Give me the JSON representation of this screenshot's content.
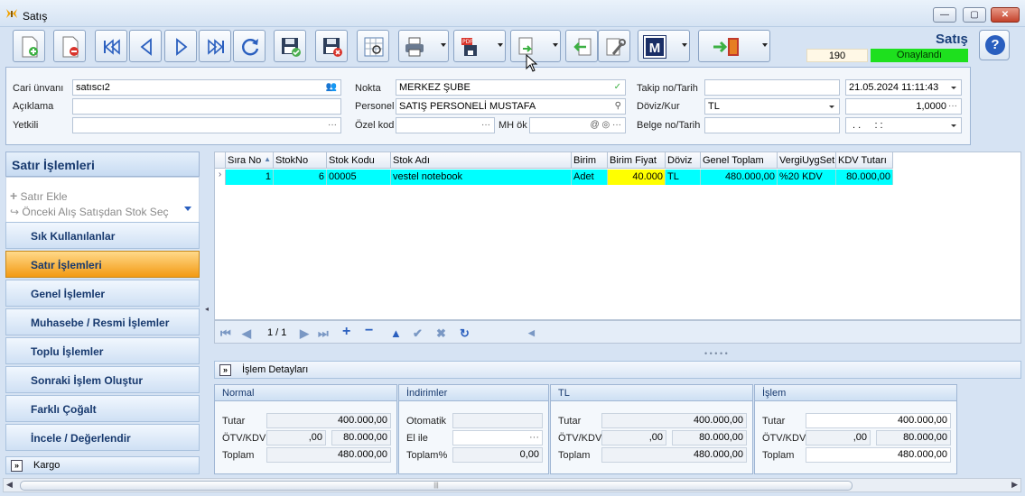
{
  "window": {
    "title": "Satış",
    "min": "—",
    "max": "▢",
    "close": "✕"
  },
  "toolbar": {
    "form_title": "Satış",
    "status_number": "190",
    "status_label": "Onaylandı",
    "help": "?",
    "m_label": "M"
  },
  "header": {
    "cari_unvani_label": "Cari ünvanı",
    "cari_unvani": "satıscı2",
    "aciklama_label": "Açıklama",
    "aciklama": "",
    "yetkili_label": "Yetkili",
    "yetkili": "",
    "nokta_label": "Nokta",
    "nokta": "MERKEZ ŞUBE",
    "personel_label": "Personel",
    "personel": "SATIŞ PERSONELİ MUSTAFA",
    "ozel_kod_label": "Özel kod",
    "ozel_kod": "",
    "mh_ok_label": "MH ök",
    "mh_ok": "",
    "takip_label": "Takip no/Tarih",
    "takip_no": "",
    "takip_tarih": "21.05.2024 11:11:43",
    "doviz_label": "Döviz/Kur",
    "doviz": "TL",
    "kur": "1,0000",
    "belge_label": "Belge no/Tarih",
    "belge_no": "",
    "belge_tarih": ". .     : :",
    "ellipsis": "···",
    "at_sign": "@"
  },
  "left": {
    "header": "Satır İşlemleri",
    "actions": [
      "Satır Ekle",
      "Önceki Alış Satışdan Stok Seç"
    ],
    "nav": [
      "Sık Kullanılanlar",
      "Satır İşlemleri",
      "Genel İşlemler",
      "Muhasebe / Resmi İşlemler",
      "Toplu İşlemler",
      "Sonraki İşlem Oluştur",
      "Farklı Çoğalt",
      "İncele / Değerlendir"
    ],
    "kargo": "Kargo"
  },
  "grid": {
    "columns": [
      "Sıra No",
      "StokNo",
      "Stok Kodu",
      "Stok Adı",
      "Birim",
      "Birim Fiyat",
      "Döviz",
      "Genel Toplam",
      "VergiUygSet",
      "KDV Tutarı"
    ],
    "row": [
      "1",
      "6",
      "00005",
      "vestel notebook",
      "Adet",
      "40.000",
      "TL",
      "480.000,00",
      "%20 KDV",
      "80.000,00"
    ],
    "page_indicator": "1 / 1"
  },
  "detail": {
    "title": "İşlem Detayları",
    "normal": {
      "title": "Normal",
      "tutar_label": "Tutar",
      "tutar": "400.000,00",
      "otv_label": "ÖTV/KDV",
      "otv": ",00",
      "kdv": "80.000,00",
      "toplam_label": "Toplam",
      "toplam": "480.000,00"
    },
    "indirimler": {
      "title": "İndirimler",
      "otomatik_label": "Otomatik",
      "otomatik": "",
      "el_ile_label": "El ile",
      "el_ile": "···",
      "toplam_label": "Toplam%",
      "toplam": "0,00"
    },
    "tl": {
      "title": "TL",
      "tutar_label": "Tutar",
      "tutar": "400.000,00",
      "otv_label": "ÖTV/KDV",
      "otv": ",00",
      "kdv": "80.000,00",
      "toplam_label": "Toplam",
      "toplam": "480.000,00"
    },
    "islem": {
      "title": "İşlem",
      "tutar_label": "Tutar",
      "tutar": "400.000,00",
      "otv_label": "ÖTV/KDV",
      "otv": ",00",
      "kdv": "80.000,00",
      "toplam_label": "Toplam",
      "toplam": "480.000,00"
    }
  },
  "colors": {
    "status_green": "#1ee01e",
    "row_cyan": "#00ffff",
    "highlight_yellow": "#ffff00",
    "active_orange": "#f39a13"
  }
}
